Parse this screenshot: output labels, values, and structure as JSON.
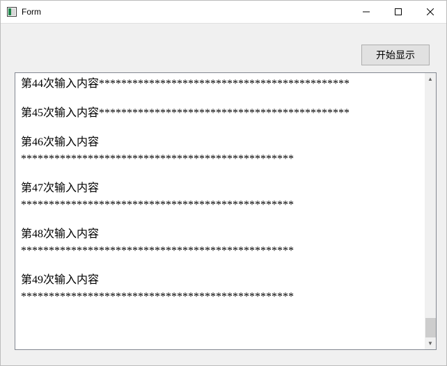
{
  "window": {
    "title": "Form"
  },
  "toolbar": {
    "start_button_label": "开始显示"
  },
  "content": {
    "lines": [
      "第44次输入内容*********************************************",
      "",
      "第45次输入内容*********************************************",
      "",
      "第46次输入内容",
      "*************************************************",
      "",
      "第47次输入内容",
      "*************************************************",
      "",
      "第48次输入内容",
      "*************************************************",
      "",
      "第49次输入内容",
      "*************************************************"
    ]
  },
  "icons": {
    "arrow_up": "▲",
    "arrow_down": "▼"
  }
}
